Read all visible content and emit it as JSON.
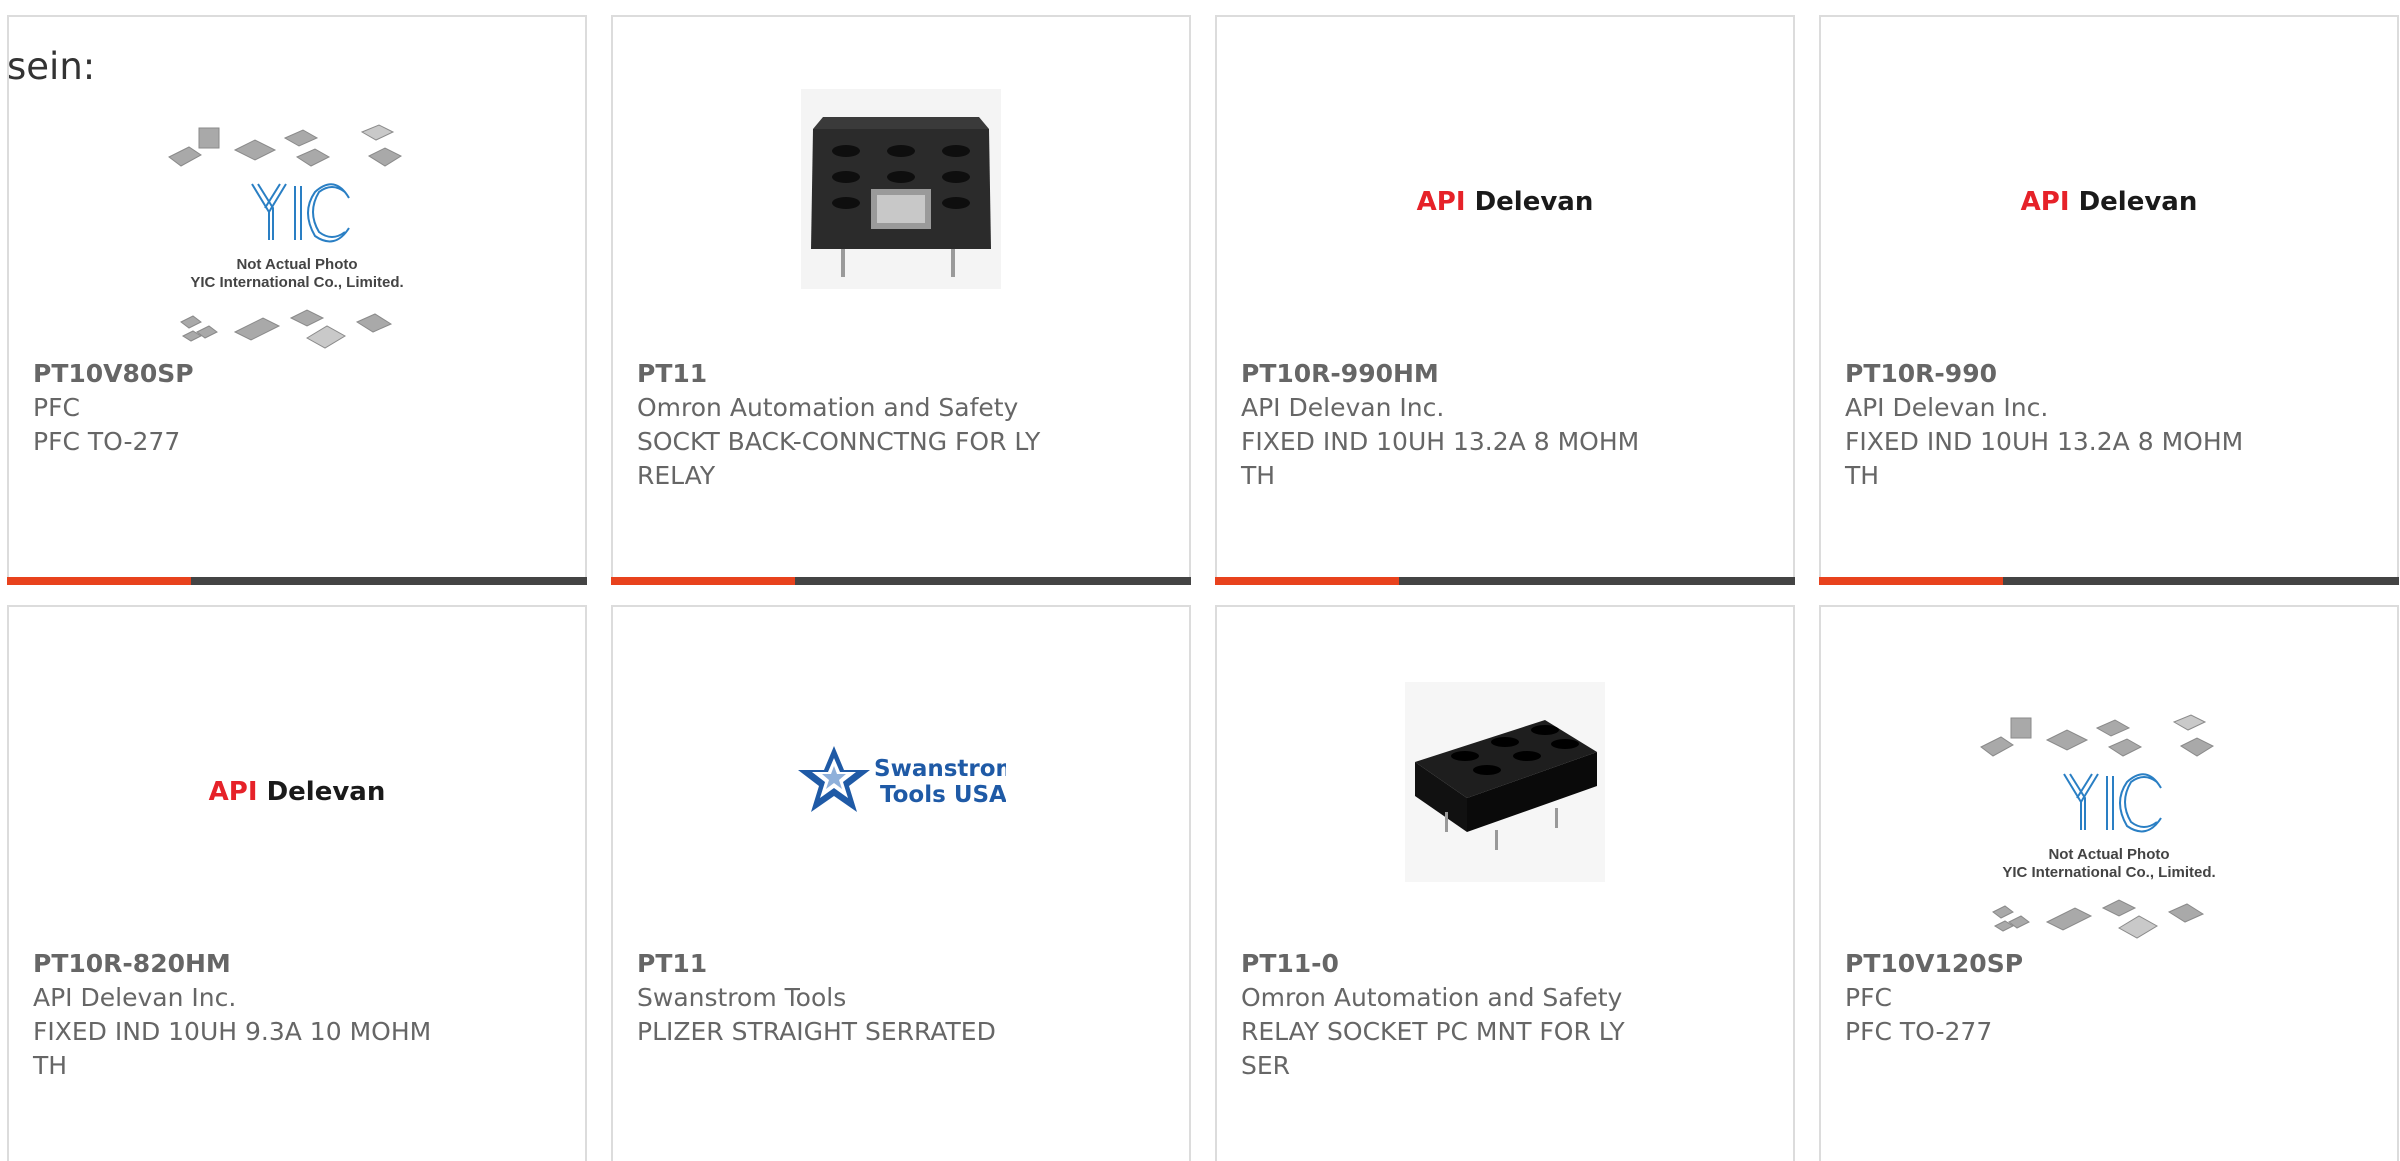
{
  "intro_text": "sein:",
  "colors": {
    "accent": "#e8421d",
    "bar": "#444444",
    "border": "#dcdcdc",
    "api_red": "#e62229",
    "swanstrom_blue": "#1f5aa6"
  },
  "products": [
    {
      "part": "PT10V80SP",
      "maker": "PFC",
      "desc": "PFC TO-277",
      "desc2": "",
      "image": "yic-placeholder",
      "caption1": "Not Actual Photo",
      "caption2": "YIC International Co., Limited."
    },
    {
      "part": "PT11",
      "maker": "Omron Automation and Safety",
      "desc": "SOCKT BACK-CONNCTNG FOR LY",
      "desc2": "RELAY",
      "image": "relay-socket-photo"
    },
    {
      "part": "PT10R-990HM",
      "maker": "API Delevan Inc.",
      "desc": "FIXED IND 10UH 13.2A 8 MOHM",
      "desc2": "TH",
      "image": "api-delevan-logo",
      "logo_a": "API",
      "logo_b": "Delevan"
    },
    {
      "part": "PT10R-990",
      "maker": "API Delevan Inc.",
      "desc": "FIXED IND 10UH 13.2A 8 MOHM",
      "desc2": "TH",
      "image": "api-delevan-logo",
      "logo_a": "API",
      "logo_b": "Delevan"
    },
    {
      "part": "PT10R-820HM",
      "maker": "API Delevan Inc.",
      "desc": "FIXED IND 10UH 9.3A 10 MOHM",
      "desc2": "TH",
      "image": "api-delevan-logo",
      "logo_a": "API",
      "logo_b": "Delevan"
    },
    {
      "part": "PT11",
      "maker": "Swanstrom Tools",
      "desc": "PLIZER STRAIGHT SERRATED",
      "desc2": "",
      "image": "swanstrom-logo",
      "logo_a": "Swanstrom",
      "logo_b": "Tools USA"
    },
    {
      "part": "PT11-0",
      "maker": "Omron Automation and Safety",
      "desc": "RELAY SOCKET PC MNT FOR LY",
      "desc2": "SER",
      "image": "relay-socket-photo"
    },
    {
      "part": "PT10V120SP",
      "maker": "PFC",
      "desc": "PFC TO-277",
      "desc2": "",
      "image": "yic-placeholder",
      "caption1": "Not Actual Photo",
      "caption2": "YIC International Co., Limited."
    }
  ]
}
